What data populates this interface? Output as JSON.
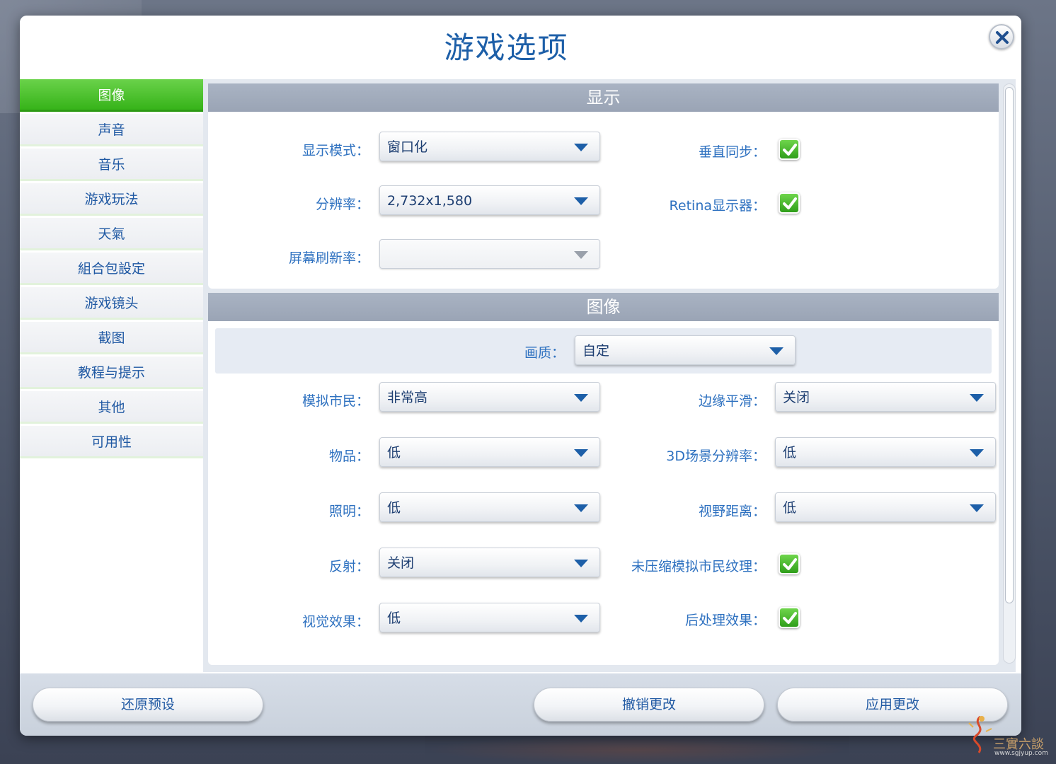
{
  "dialog": {
    "title": "游戏选项"
  },
  "sidebar": {
    "items": [
      {
        "label": "图像",
        "active": true
      },
      {
        "label": "声音",
        "active": false
      },
      {
        "label": "音乐",
        "active": false
      },
      {
        "label": "游戏玩法",
        "active": false
      },
      {
        "label": "天氣",
        "active": false
      },
      {
        "label": "組合包設定",
        "active": false
      },
      {
        "label": "游戏镜头",
        "active": false
      },
      {
        "label": "截图",
        "active": false
      },
      {
        "label": "教程与提示",
        "active": false
      },
      {
        "label": "其他",
        "active": false
      },
      {
        "label": "可用性",
        "active": false
      }
    ]
  },
  "display_section": {
    "title": "显示",
    "display_mode": {
      "label": "显示模式：",
      "value": "窗口化"
    },
    "resolution": {
      "label": "分辨率：",
      "value": "2,732x1,580"
    },
    "refresh_rate": {
      "label": "屏幕刷新率：",
      "value": ""
    },
    "vsync": {
      "label": "垂直同步：",
      "checked": true
    },
    "retina": {
      "label": "Retina显示器：",
      "checked": true
    }
  },
  "graphics_section": {
    "title": "图像",
    "quality": {
      "label": "画质：",
      "value": "自定"
    },
    "sims": {
      "label": "模拟市民：",
      "value": "非常高"
    },
    "objects": {
      "label": "物品：",
      "value": "低"
    },
    "lighting": {
      "label": "照明：",
      "value": "低"
    },
    "reflections": {
      "label": "反射：",
      "value": "关闭"
    },
    "visual_effects": {
      "label": "视觉效果：",
      "value": "低"
    },
    "edge_smoothing": {
      "label": "边缘平滑：",
      "value": "关闭"
    },
    "scene_resolution_3d": {
      "label": "3D场景分辨率：",
      "value": "低"
    },
    "view_distance": {
      "label": "视野距离：",
      "value": "低"
    },
    "uncompressed_textures": {
      "label": "未压缩模拟市民纹理：",
      "checked": true
    },
    "post_processing": {
      "label": "后处理效果：",
      "checked": true
    }
  },
  "footer": {
    "restore_defaults": "还原预设",
    "cancel_changes": "撤销更改",
    "apply_changes": "应用更改"
  },
  "watermark": {
    "text": "三實六談",
    "url": "www.sgjyup.com"
  },
  "colors": {
    "accent_green": "#36b319",
    "label_blue": "#2e71c0",
    "header_gray": "#9aa4b5"
  },
  "icons": {
    "close": "close-icon",
    "dropdown": "chevron-down-icon",
    "check": "checkmark-icon"
  }
}
